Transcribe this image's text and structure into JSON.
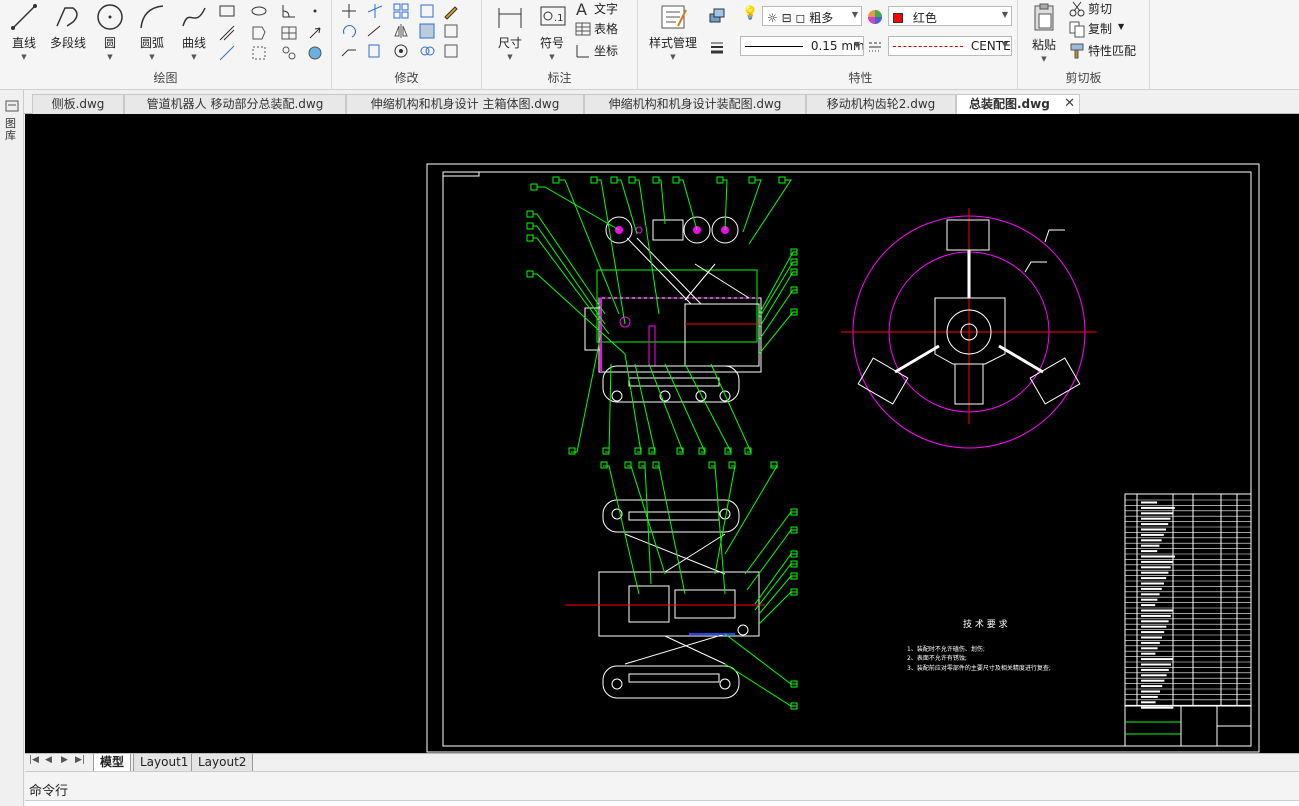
{
  "ribbon": {
    "draw": {
      "title": "绘图",
      "line": "直线",
      "polyline": "多段线",
      "circle": "圆",
      "arc": "圆弧",
      "curve": "曲线"
    },
    "modify": {
      "title": "修改"
    },
    "annotate": {
      "title": "标注",
      "dimension": "尺寸",
      "symbol": "符号",
      "text": "文字",
      "table": "表格",
      "coord": "坐标"
    },
    "style": {
      "label": "样式管理"
    },
    "properties": {
      "title": "特性",
      "layer": "粗多",
      "color": "红色",
      "lineweight": "0.15 mm",
      "linetype": "CENTE"
    },
    "clipboard": {
      "title": "剪切板",
      "paste": "粘贴",
      "cut": "剪切",
      "copy": "复制",
      "match": "特性匹配"
    }
  },
  "side_panel_label": "图库",
  "tabs": [
    {
      "label": "侧板.dwg",
      "active": false
    },
    {
      "label": "管道机器人 移动部分总装配.dwg",
      "active": false
    },
    {
      "label": "伸缩机构和机身设计 主箱体图.dwg",
      "active": false
    },
    {
      "label": "伸缩机构和机身设计装配图.dwg",
      "active": false
    },
    {
      "label": "移动机构齿轮2.dwg",
      "active": false
    },
    {
      "label": "总装配图.dwg",
      "active": true
    }
  ],
  "drawing": {
    "tech_title": "技 术 要 求",
    "notes": [
      "1、装配时不允许磕伤、划伤;",
      "2、表面不允许有锈蚀;",
      "3、装配前应对零部件的主要尺寸及相关精度进行复查;"
    ]
  },
  "layout_tabs": [
    "模型",
    "Layout1",
    "Layout2"
  ],
  "command": {
    "label": "命令行"
  },
  "colors": {
    "canvas": "#000000",
    "white_lines": "#ffffff",
    "green_leaders": "#00ff00",
    "magenta": "#ff00ff",
    "red_center": "#ff0000",
    "blue": "#2040ff"
  }
}
